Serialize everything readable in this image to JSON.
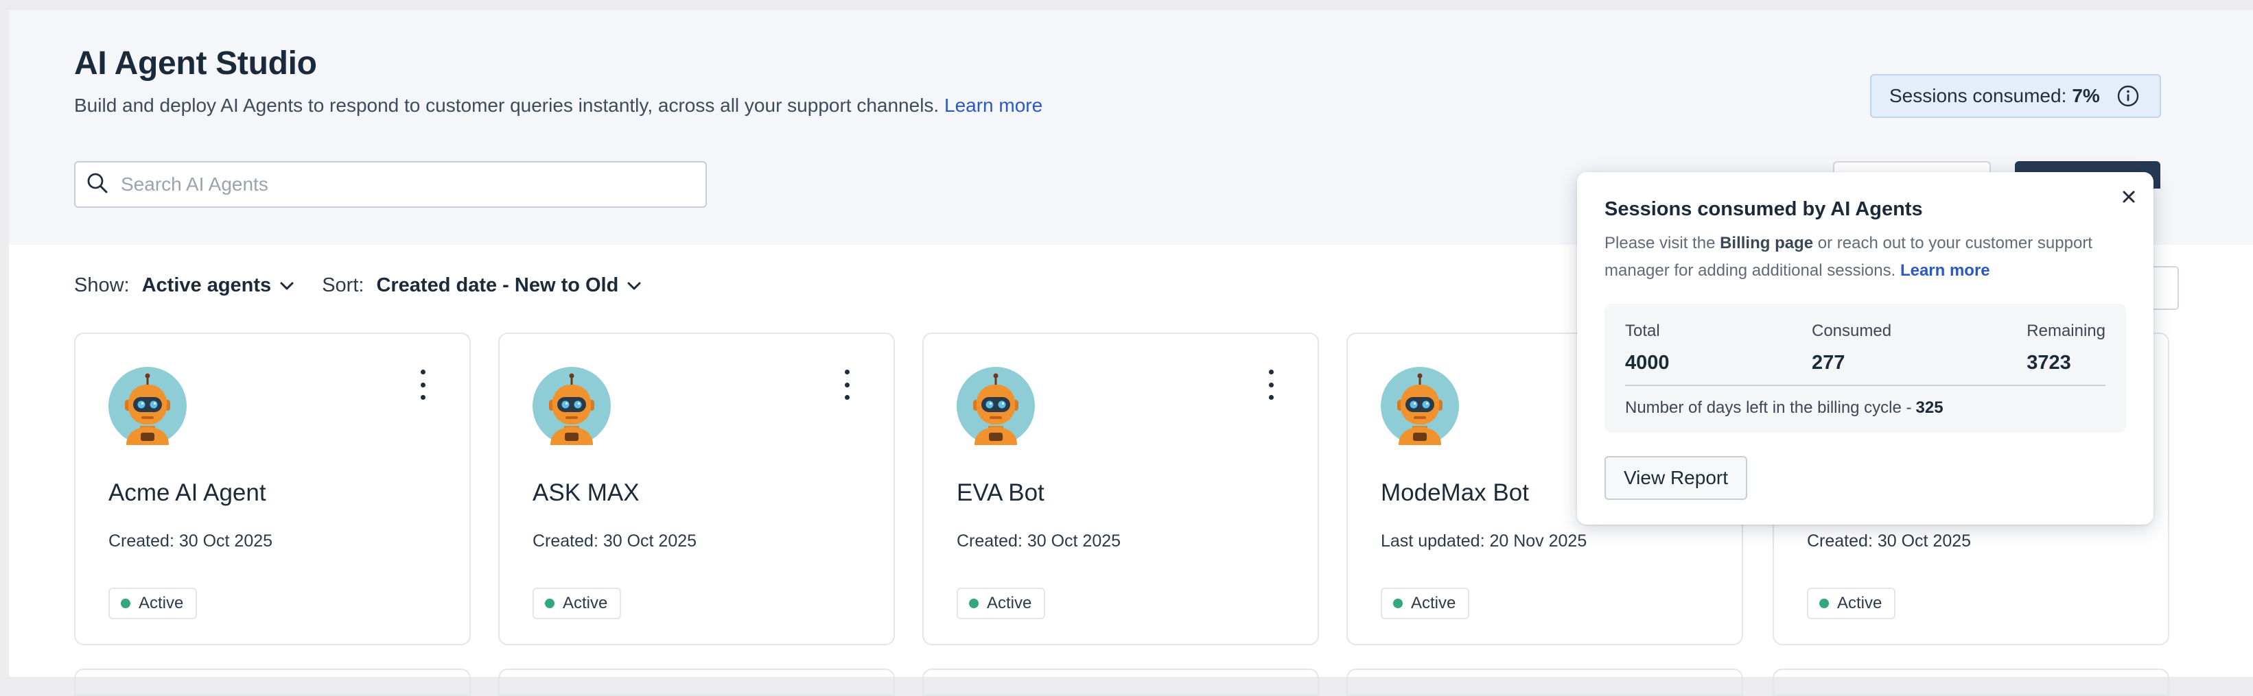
{
  "header": {
    "title": "AI Agent Studio",
    "subtitle": "Build and deploy AI Agents to respond to customer queries instantly, across all your support channels.",
    "learn_more": "Learn more"
  },
  "sessions_chip": {
    "label": "Sessions consumed:",
    "percent": "7%"
  },
  "search": {
    "placeholder": "Search AI Agents",
    "value": ""
  },
  "filters": {
    "show_label": "Show:",
    "show_value": "Active agents",
    "sort_label": "Sort:",
    "sort_value": "Created date - New to Old"
  },
  "agents": [
    {
      "name": "Acme AI Agent",
      "meta": "Created: 30 Oct 2025",
      "status": "Active"
    },
    {
      "name": "ASK MAX",
      "meta": "Created: 30 Oct 2025",
      "status": "Active"
    },
    {
      "name": "EVA Bot",
      "meta": "Created: 30 Oct 2025",
      "status": "Active"
    },
    {
      "name": "ModeMax Bot",
      "meta": "Last updated: 20 Nov 2025",
      "status": "Active"
    },
    {
      "name": "",
      "meta": "Created: 30 Oct 2025",
      "status": "Active"
    }
  ],
  "popover": {
    "title": "Sessions consumed by AI Agents",
    "desc_pre": "Please visit the",
    "desc_billing": "Billing page",
    "desc_mid": "or reach out to your customer support manager for adding additional sessions.",
    "learn_more": "Learn more",
    "total_label": "Total",
    "total_value": "4000",
    "consumed_label": "Consumed",
    "consumed_value": "277",
    "remaining_label": "Remaining",
    "remaining_value": "3723",
    "days_label": "Number of days left in the billing cycle -",
    "days_value": "325",
    "report_button": "View Report"
  },
  "colors": {
    "accent_link": "#2859c5",
    "status_active": "#35a77c",
    "primary_button": "#253a52",
    "header_band": "#f4f6f9"
  },
  "icons": {
    "search": "search-icon",
    "info": "info-icon",
    "chevron": "chevron-down-icon",
    "kebab": "kebab-menu-icon",
    "close": "close-icon",
    "avatar": "robot-avatar-icon"
  }
}
